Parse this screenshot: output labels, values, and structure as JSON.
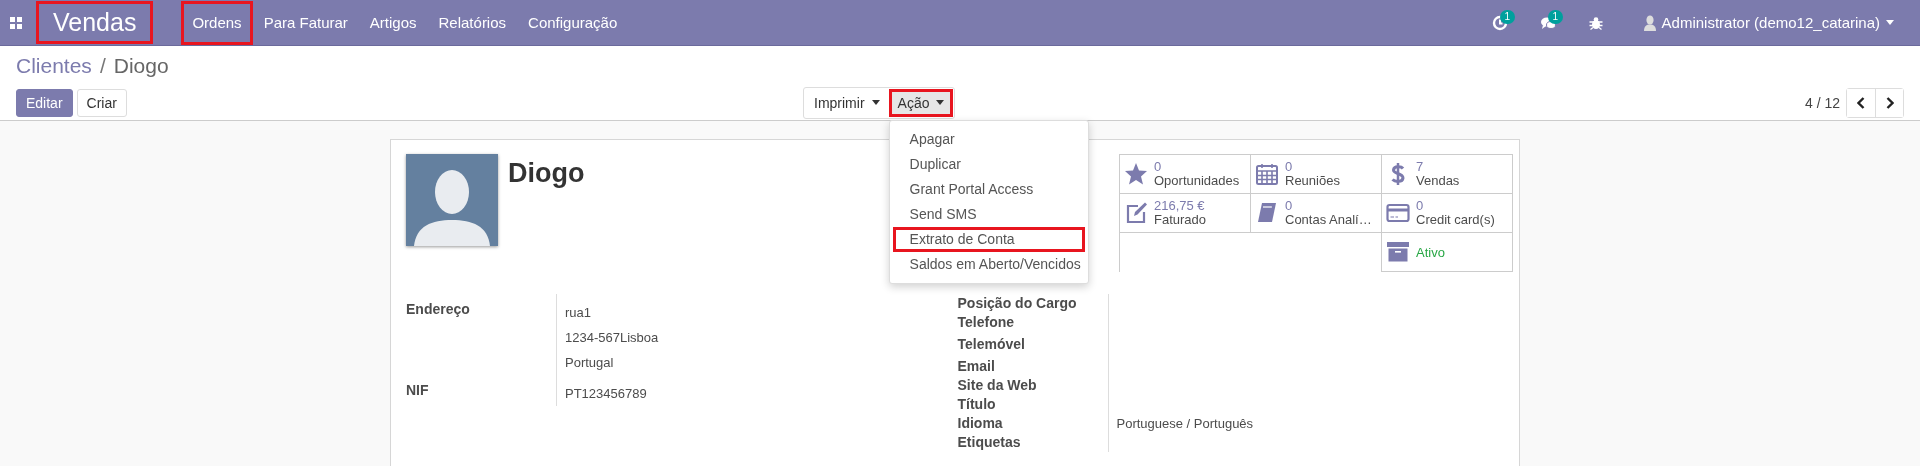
{
  "navbar": {
    "brand": {
      "label": "Vendas",
      "highlighted": true
    },
    "menu": [
      {
        "label": "Ordens",
        "highlighted": true
      },
      {
        "label": "Para Faturar",
        "highlighted": false
      },
      {
        "label": "Artigos",
        "highlighted": false
      },
      {
        "label": "Relatórios",
        "highlighted": false
      },
      {
        "label": "Configuração",
        "highlighted": false
      }
    ],
    "systray": [
      {
        "kind": "activity",
        "badge": "1"
      },
      {
        "kind": "messages",
        "badge": "1"
      },
      {
        "kind": "debug"
      }
    ],
    "user": {
      "label": "Administrator (demo12_catarina)"
    }
  },
  "breadcrumb": {
    "items": [
      {
        "label": "Clientes",
        "link": true
      },
      {
        "label": "Diogo",
        "link": false
      }
    ],
    "separator": "/"
  },
  "buttons": [
    {
      "label": "Editar",
      "kind": "primary"
    },
    {
      "label": "Criar",
      "kind": "secondary"
    }
  ],
  "action_bar": [
    {
      "label": "Imprimir",
      "highlighted": false,
      "expanded": false
    },
    {
      "label": "Ação",
      "highlighted": true,
      "expanded": true,
      "items": [
        {
          "label": "Apagar",
          "highlighted": false
        },
        {
          "label": "Duplicar",
          "highlighted": false
        },
        {
          "label": "Grant Portal Access",
          "highlighted": false
        },
        {
          "label": "Send SMS",
          "highlighted": false
        },
        {
          "label": "Extrato de Conta",
          "highlighted": true
        },
        {
          "label": "Saldos em Aberto/Vencidos",
          "highlighted": false
        }
      ]
    }
  ],
  "pager": {
    "value": "4 / 12"
  },
  "stat_buttons": [
    {
      "kind": "stat",
      "value": "0",
      "label": "Oportunidades"
    },
    {
      "kind": "stat",
      "value": "0",
      "label": "Reuniões"
    },
    {
      "kind": "stat",
      "value": "7",
      "label": "Vendas"
    },
    {
      "kind": "stat",
      "value": "216,75 €",
      "label": "Faturado"
    },
    {
      "kind": "stat",
      "value": "0",
      "label": "Contas Analí…"
    },
    {
      "kind": "stat",
      "value": "0",
      "label": "Credit card(s)"
    },
    {
      "kind": "toggle",
      "label": "Ativo",
      "on": true
    }
  ],
  "partner": {
    "name": "Diogo"
  },
  "left_fields": [
    {
      "label": "Endereço",
      "values": [
        "rua1",
        "1234-567Lisboa",
        "Portugal"
      ]
    },
    {
      "label": "NIF",
      "values": [
        "PT123456789"
      ]
    }
  ],
  "right_fields": [
    {
      "label": "Posição do Cargo"
    },
    {
      "label": "Telefone"
    },
    {
      "label": "Telemóvel"
    },
    {
      "label": "Email"
    },
    {
      "label": "Site da Web"
    },
    {
      "label": "Título"
    },
    {
      "label": "Idioma",
      "value": "Portuguese / Português"
    },
    {
      "label": "Etiquetas"
    }
  ]
}
